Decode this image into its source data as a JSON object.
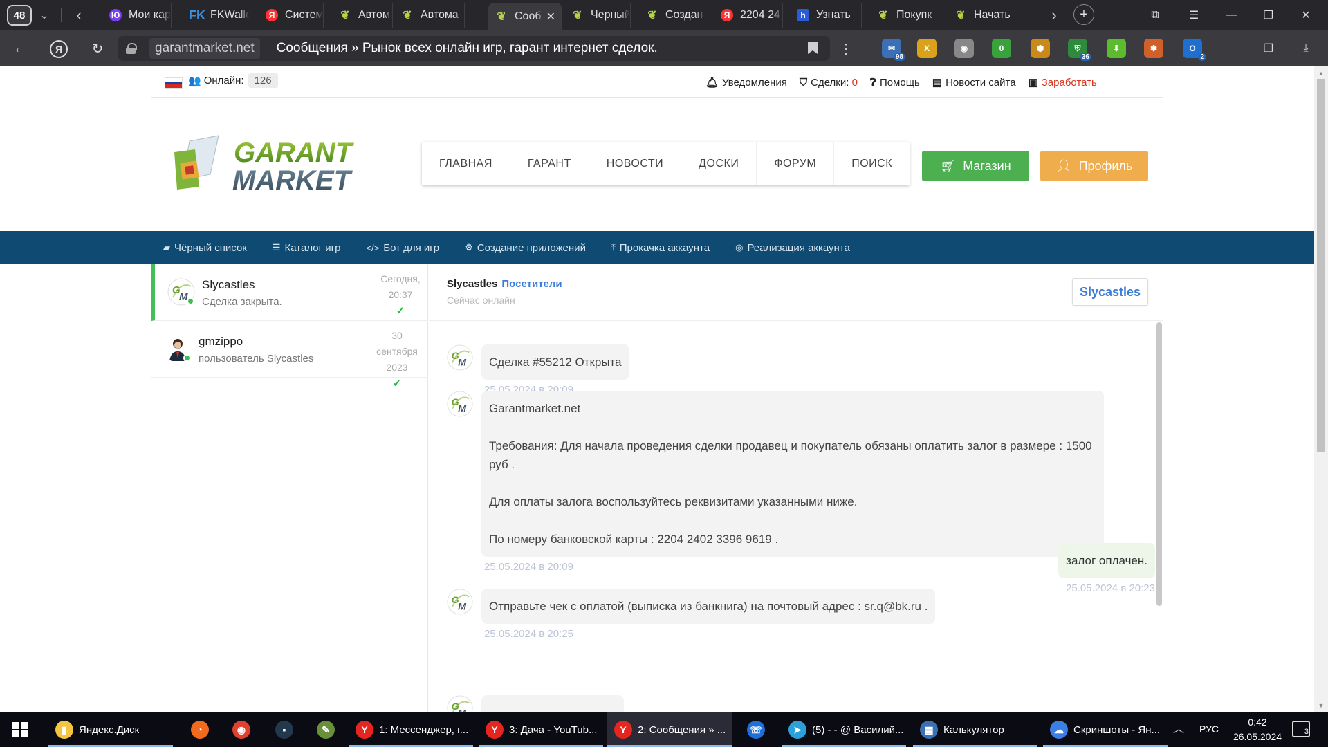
{
  "browser": {
    "tab_count": "48",
    "tabs": [
      {
        "title": "Мои кар",
        "favicon": "yu",
        "fav_text": "Ю"
      },
      {
        "title": "FKWalle",
        "favicon": "fk",
        "fav_text": "FK"
      },
      {
        "title": "Систем",
        "favicon": "ya",
        "fav_text": "Я"
      },
      {
        "title": "Автома",
        "favicon": "leaf",
        "fav_text": "❦"
      },
      {
        "title": "Автома",
        "favicon": "leaf",
        "fav_text": "❦"
      },
      {
        "title": "Сооб",
        "favicon": "leaf",
        "fav_text": "❦",
        "active": true
      },
      {
        "title": "Черный",
        "favicon": "leaf",
        "fav_text": "❦"
      },
      {
        "title": "Создан",
        "favicon": "leaf",
        "fav_text": "❦"
      },
      {
        "title": "2204 24",
        "favicon": "ya",
        "fav_text": "Я"
      },
      {
        "title": "Узнать",
        "favicon": "bl",
        "fav_text": "h"
      },
      {
        "title": "Покупк",
        "favicon": "leaf",
        "fav_text": "❦"
      },
      {
        "title": "Начать",
        "favicon": "leaf",
        "fav_text": "❦"
      }
    ],
    "address": {
      "host": "garantmarket.net",
      "title": "Сообщения » Рынок всех онлайн игр, гарант интернет сделок."
    },
    "extensions": [
      {
        "name": "mail-ext",
        "badge": "98",
        "color": "#3b6fb6",
        "glyph": "✉"
      },
      {
        "name": "excel-ext",
        "badge": "",
        "color": "#d9a21a",
        "glyph": "X"
      },
      {
        "name": "circle-ext",
        "badge": "",
        "color": "#888888",
        "glyph": "◉"
      },
      {
        "name": "counter-ext",
        "badge": "",
        "color": "#3aa23a",
        "glyph": "0"
      },
      {
        "name": "hex-ext",
        "badge": "",
        "color": "#c98a1a",
        "glyph": "⬢"
      },
      {
        "name": "shield-ext",
        "badge": "36",
        "color": "#2e8b3e",
        "glyph": "⛨"
      },
      {
        "name": "download-ext",
        "badge": "",
        "color": "#5dbb2e",
        "glyph": "⬇"
      },
      {
        "name": "puzzle-ext",
        "badge": "",
        "color": "#d0602a",
        "glyph": "✱"
      },
      {
        "name": "outlook-ext",
        "badge": "2",
        "color": "#1f6fd1",
        "glyph": "O"
      }
    ]
  },
  "site": {
    "online_label": "Онлайн:",
    "online_count": "126",
    "toplinks": {
      "notifications": "Уведомления",
      "deals_label": "Сделки:",
      "deals_count": "0",
      "help": "Помощь",
      "news": "Новости сайта",
      "earn": "Заработать"
    },
    "logo": {
      "line1": "GARANT",
      "line2": "MARKET"
    },
    "nav": [
      "ГЛАВНАЯ",
      "ГАРАНТ",
      "НОВОСТИ",
      "ДОСКИ",
      "ФОРУМ",
      "ПОИСК"
    ],
    "shop_button": "Магазин",
    "profile_button": "Профиль",
    "subnav": [
      {
        "label": "Чёрный список",
        "icon": "book-icon",
        "glyph": "▰"
      },
      {
        "label": "Каталог игр",
        "icon": "list-icon",
        "glyph": "☰"
      },
      {
        "label": "Бот для игр",
        "icon": "code-icon",
        "glyph": "</>"
      },
      {
        "label": "Создание приложений",
        "icon": "gears-icon",
        "glyph": "⚙"
      },
      {
        "label": "Прокачка аккаунта",
        "icon": "level-up-icon",
        "glyph": "⤒"
      },
      {
        "label": "Реализация аккаунта",
        "icon": "handshake-icon",
        "glyph": "◎"
      }
    ]
  },
  "conversations": [
    {
      "name": "Slycastles",
      "preview": "Сделка закрыта.",
      "time_line1": "Сегодня,",
      "time_line2": "20:37",
      "time_line3": ""
    },
    {
      "name": "gmzippo",
      "preview": "пользователь Slycastles",
      "time_line1": "30",
      "time_line2": "сентября",
      "time_line3": "2023"
    }
  ],
  "chat": {
    "user": "Slycastles",
    "visitors": "Посетители",
    "status": "Сейчас онлайн",
    "user_button": "Slycastles",
    "messages": [
      {
        "lines": [
          "Сделка #55212 Открыта"
        ],
        "time": "25.05.2024 в 20:09"
      },
      {
        "lines": [
          "Garantmarket.net",
          "",
          "Требования: Для начала проведения сделки продавец и покупатель обязаны оплатить залог в размере : 1500",
          "руб .",
          "",
          "Для оплаты залога воспользуйтесь реквизитами указанными ниже.",
          "",
          "По номеру банковской карты : 2204 2402 3396 9619 ."
        ],
        "time": "25.05.2024 в 20:09"
      },
      {
        "lines": [
          "залог оплачен."
        ],
        "time": "25.05.2024 в 20:23",
        "outgoing": true
      },
      {
        "lines": [
          "Отправьте чек с оплатой (выписка из банкнига) на почтовый адрес : sr.q@bk.ru ."
        ],
        "time": "25.05.2024 в 20:25"
      }
    ]
  },
  "taskbar": {
    "items": [
      {
        "label": "Яндекс.Диск",
        "icon": "yandex-disk-icon",
        "color": "#f5c542",
        "glyph": "▮"
      },
      {
        "label": "",
        "icon": "timer-app-icon",
        "color": "#f06b1d",
        "glyph": "◔"
      },
      {
        "label": "",
        "icon": "chrome-icon",
        "color": "#e0412f",
        "glyph": "◉"
      },
      {
        "label": "",
        "icon": "terminal-app-icon",
        "color": "#22384d",
        "glyph": "▪"
      },
      {
        "label": "",
        "icon": "notepad-app-icon",
        "color": "#6a8f3a",
        "glyph": "✎"
      },
      {
        "label": "1: Мессенджер, г...",
        "icon": "yandex-browser-icon",
        "color": "#e52620",
        "glyph": "Y"
      },
      {
        "label": "3: Дача - YouTub...",
        "icon": "yandex-browser-icon",
        "color": "#e52620",
        "glyph": "Y"
      },
      {
        "label": "2: Сообщения » ...",
        "icon": "yandex-browser-icon",
        "color": "#e52620",
        "glyph": "Y"
      },
      {
        "label": "",
        "icon": "phone-app-icon",
        "color": "#1e6fd9",
        "glyph": "☏"
      },
      {
        "label": "(5) - - @ Василий...",
        "icon": "telegram-icon",
        "color": "#2aa1da",
        "glyph": "➤"
      },
      {
        "label": "Калькулятор",
        "icon": "calculator-icon",
        "color": "#3b6fb6",
        "glyph": "▦"
      },
      {
        "label": "Скриншоты - Ян...",
        "icon": "yandex-disk-icon",
        "color": "#3a7ee6",
        "glyph": "☁"
      }
    ],
    "lang": "РУС",
    "time": "0:42",
    "date": "26.05.2024",
    "notifications": "3"
  }
}
